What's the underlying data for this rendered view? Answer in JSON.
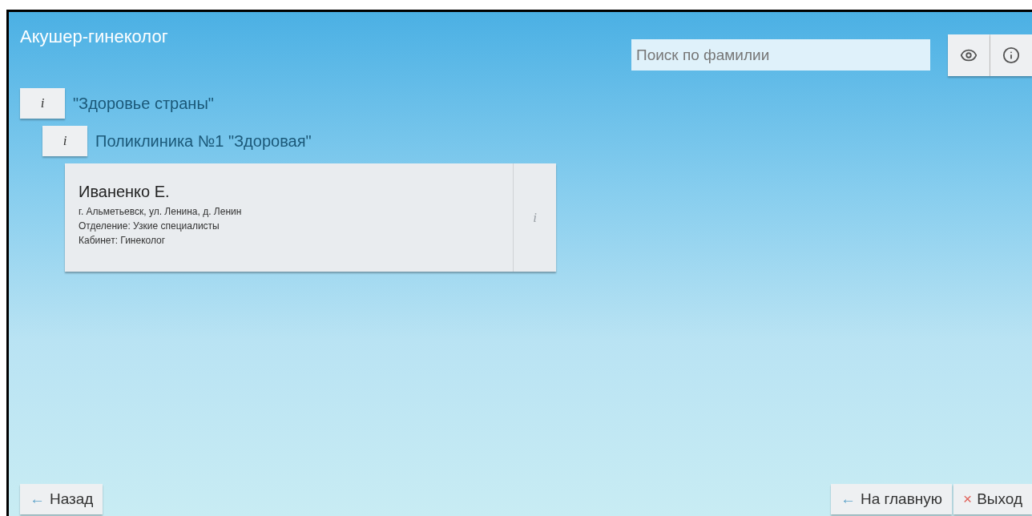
{
  "title": "Акушер-гинеколог",
  "search": {
    "placeholder": "Поиск по фамилии"
  },
  "tree": [
    {
      "info_label": "i",
      "name": "\"Здоровье страны\"",
      "children": [
        {
          "info_label": "i",
          "name": "Поликлиника №1 \"Здоровая\"",
          "doctors": [
            {
              "name": "Иваненко Е.",
              "lines": [
                "г. Альметьевск, ул. Ленина, д. Ленин",
                "Отделение: Узкие специалисты",
                "Кабинет: Гинеколог"
              ],
              "info_label": "i",
              "info_disabled": true
            }
          ]
        }
      ]
    }
  ],
  "footer": {
    "left": [
      {
        "icon": "←",
        "label": "Назад"
      }
    ],
    "right": [
      {
        "icon": "←",
        "label": "На главную",
        "kind": "home"
      },
      {
        "icon": "×",
        "label": "Выход",
        "kind": "exit"
      }
    ]
  }
}
